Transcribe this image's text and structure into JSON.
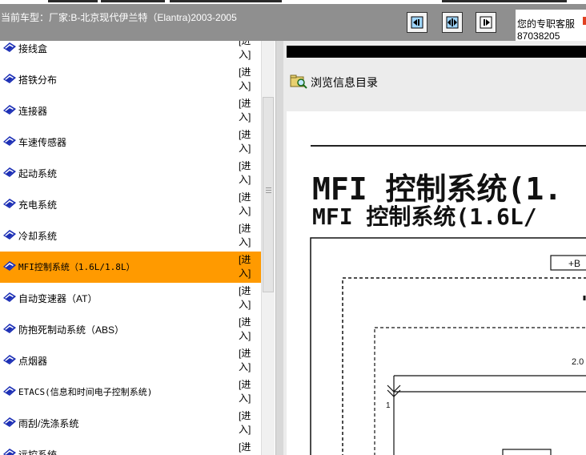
{
  "header": {
    "title": "当前车型：厂家:B-北京现代伊兰特（Elantra)2003-2005",
    "support_label": "您的专职客服",
    "support_number": "87038205"
  },
  "toolbar": {
    "buttons": [
      {
        "name": "nav-left-button",
        "icon": "page-left-icon"
      },
      {
        "name": "nav-split-button",
        "icon": "split-view-icon"
      },
      {
        "name": "nav-right-button",
        "icon": "page-right-icon"
      }
    ]
  },
  "list": {
    "enter_label": "[进入]",
    "items": [
      {
        "label": "接线盒"
      },
      {
        "label": "搭铁分布"
      },
      {
        "label": "连接器"
      },
      {
        "label": "车速传感器"
      },
      {
        "label": "起动系统"
      },
      {
        "label": "充电系统"
      },
      {
        "label": "冷却系统"
      },
      {
        "label": "MFI控制系统（1.6L/1.8L）",
        "selected": true
      },
      {
        "label": "自动变速器（AT）"
      },
      {
        "label": "防抱死制动系统（ABS）"
      },
      {
        "label": "点烟器"
      },
      {
        "label": "ETACS(信息和时间电子控制系统)"
      },
      {
        "label": "雨刮/洗涤系统"
      },
      {
        "label": "远控系统"
      }
    ]
  },
  "viewer": {
    "browse_label": "浏览信息目录",
    "doc_title_large": "MFI 控制系统(1.",
    "doc_title_small": "MFI 控制系统(1.6L/",
    "diagram_labels": {
      "plus_b": "+B",
      "value": "2.0",
      "pin": "1"
    }
  },
  "colors": {
    "header_bg": "#8f8f8f",
    "selected_row": "#ff9a00",
    "icon_blue": "#1c2fb5"
  }
}
